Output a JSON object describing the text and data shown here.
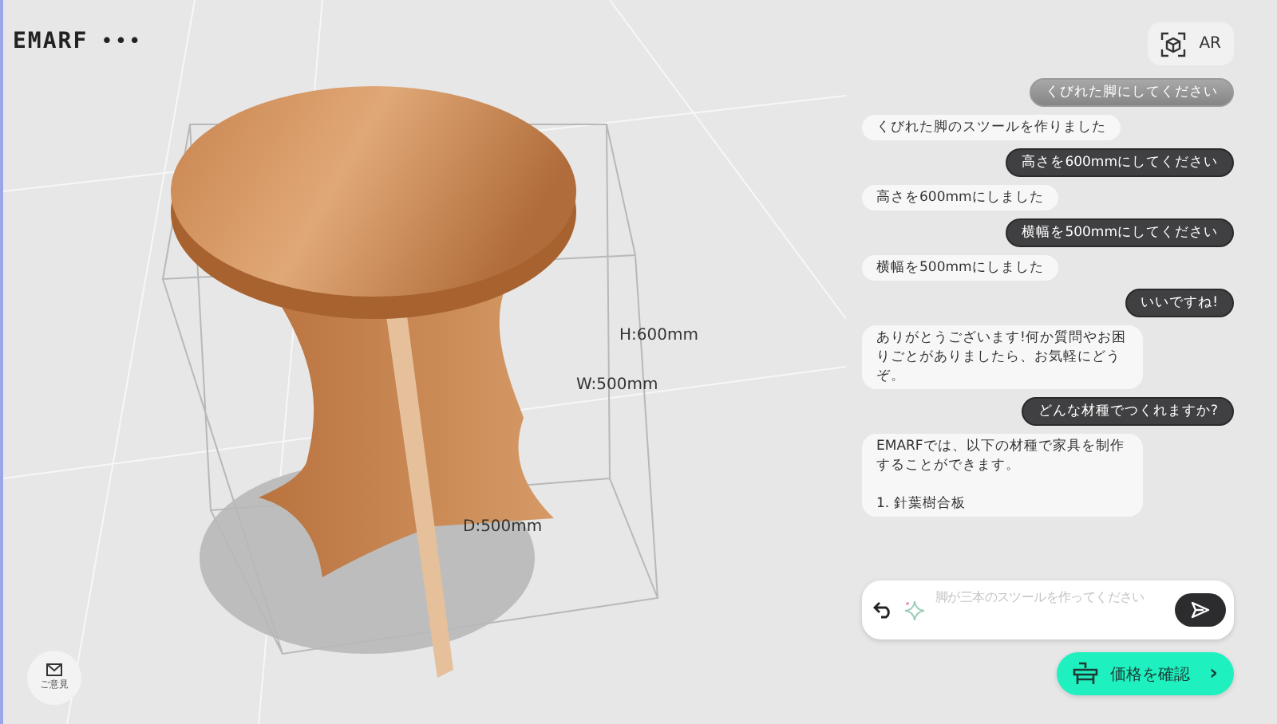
{
  "header": {
    "logo": "EMARF",
    "menu": "•••"
  },
  "ar_button": {
    "label": "AR"
  },
  "dimensions": {
    "height": "H:600mm",
    "width": "W:500mm",
    "depth": "D:500mm"
  },
  "messages": [
    {
      "kind": "user",
      "text": "くびれた脚にしてください",
      "faded": true
    },
    {
      "kind": "bot",
      "text": "くびれた脚のスツールを作りました",
      "faded": false
    },
    {
      "kind": "user",
      "text": "高さを600mmにしてください",
      "faded": false
    },
    {
      "kind": "bot",
      "text": "高さを600mmにしました",
      "faded": false
    },
    {
      "kind": "user",
      "text": "横幅を500mmにしてください",
      "faded": false
    },
    {
      "kind": "bot",
      "text": "横幅を500mmにしました",
      "faded": false
    },
    {
      "kind": "user",
      "text": "いいですね!",
      "faded": false
    },
    {
      "kind": "bot",
      "text": "ありがとうございます!何か質問やお困りごとがありましたら、お気軽にどうぞ。",
      "faded": false
    },
    {
      "kind": "user",
      "text": "どんな材種でつくれますか?",
      "faded": false
    },
    {
      "kind": "bot",
      "text": "EMARFでは、以下の材種で家具を制作することができます。\n\n1. 針葉樹合板",
      "faded": false
    }
  ],
  "input": {
    "placeholder": "脚が三本のスツールを作ってください"
  },
  "price_button": {
    "label": "価格を確認",
    "chevron": "›"
  },
  "feedback_button": {
    "label": "ご意見"
  }
}
